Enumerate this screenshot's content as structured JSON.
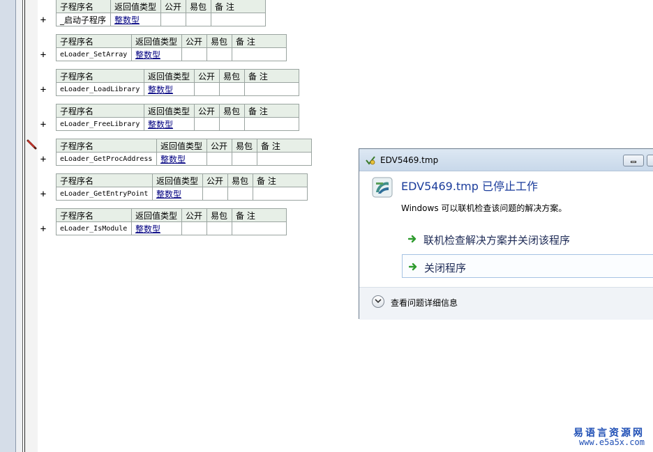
{
  "editor": {
    "header": {
      "name": "子程序名",
      "return_type": "返回值类型",
      "public": "公开",
      "easy_pack": "易包",
      "remark": "备 注"
    },
    "expand_symbol": "+",
    "subroutines": [
      {
        "name": "_启动子程序",
        "return_type": "整数型"
      },
      {
        "name": "eLoader_SetArray",
        "return_type": "整数型"
      },
      {
        "name": "eLoader_LoadLibrary",
        "return_type": "整数型"
      },
      {
        "name": "eLoader_FreeLibrary",
        "return_type": "整数型"
      },
      {
        "name": "eLoader_GetProcAddress",
        "return_type": "整数型"
      },
      {
        "name": "eLoader_GetEntryPoint",
        "return_type": "整数型"
      },
      {
        "name": "eLoader_IsModule",
        "return_type": "整数型"
      }
    ]
  },
  "dialog": {
    "title": "EDV5469.tmp",
    "heading": "EDV5469.tmp 已停止工作",
    "description": "Windows 可以联机检查该问题的解决方案。",
    "options": [
      {
        "label": "联机检查解决方案并关闭该程序"
      },
      {
        "label": "关闭程序"
      }
    ],
    "details_label": "查看问题详细信息",
    "accent_color": "#1b3c9b"
  },
  "watermark": {
    "line1": "易语言资源网",
    "line2": "www.e5a5x.com"
  }
}
